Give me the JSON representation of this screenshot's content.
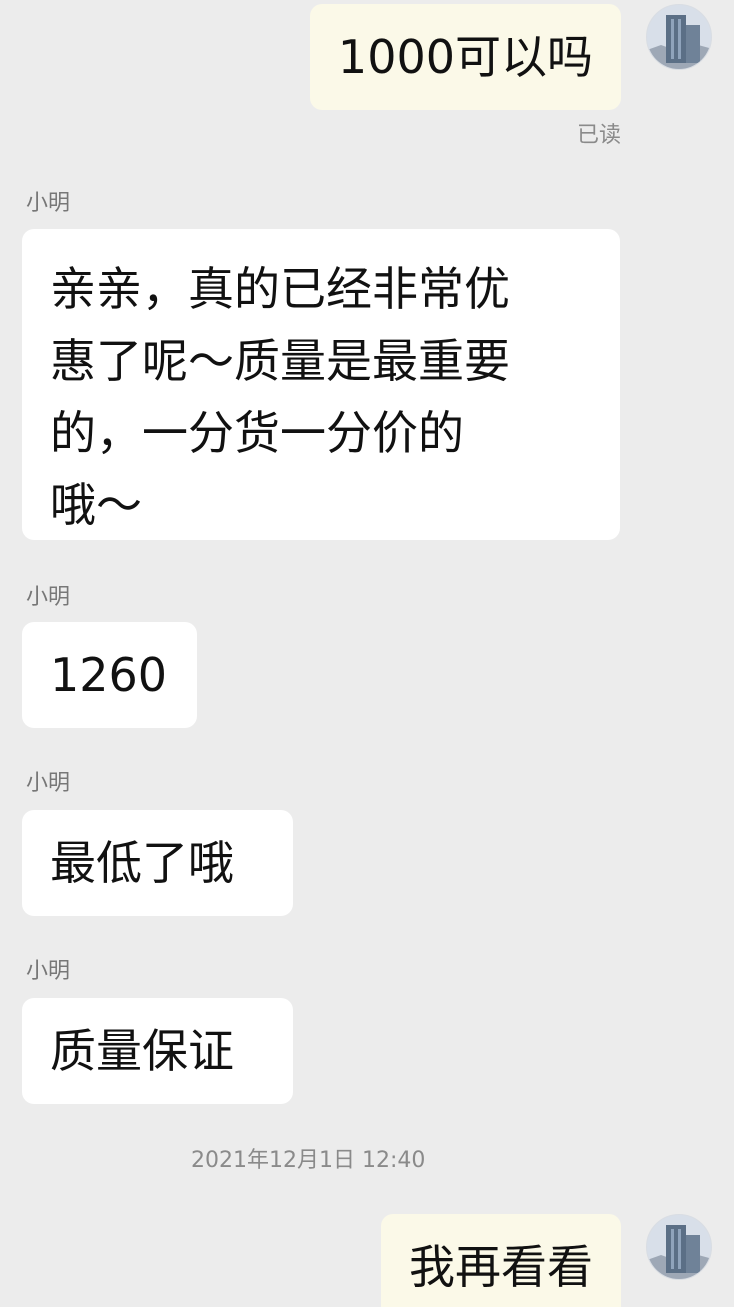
{
  "messages": [
    {
      "sender": "me",
      "text": "1000可以吗",
      "status": "已读"
    },
    {
      "sender": "小明",
      "text_lines": [
        "亲亲，真的已经非常优",
        "惠了呢～质量是最重要",
        "的，一分货一分价的",
        "哦～"
      ]
    },
    {
      "sender": "小明",
      "text": "1260"
    },
    {
      "sender": "小明",
      "text": "最低了哦"
    },
    {
      "sender": "小明",
      "text": "质量保证"
    },
    {
      "timestamp": "2021年12月1日 12:40"
    },
    {
      "sender": "me",
      "text": "我再看看"
    }
  ],
  "colors": {
    "background": "#ececec",
    "my_bubble": "#fbf9e8",
    "their_bubble": "#ffffff",
    "meta_text": "#8a8a8a",
    "sender_text": "#777777"
  },
  "icons": [
    "avatar-icon"
  ]
}
